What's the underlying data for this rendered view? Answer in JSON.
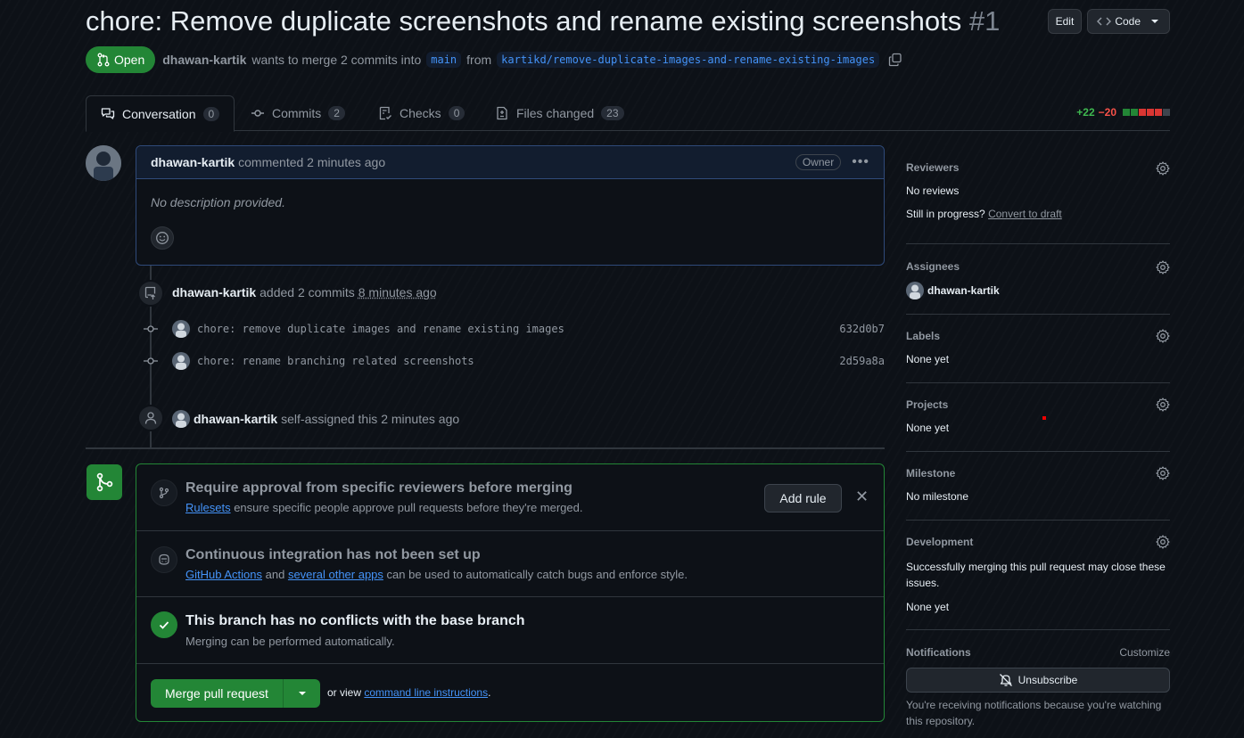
{
  "pr": {
    "title": "chore: Remove duplicate screenshots and rename existing screenshots",
    "number": "#1",
    "state": "Open",
    "author": "dhawan-kartik",
    "merge_text": "wants to merge 2 commits into",
    "base_branch": "main",
    "from_text": "from",
    "head_branch": "kartikd/remove-duplicate-images-and-rename-existing-images",
    "edit_label": "Edit",
    "code_label": "Code"
  },
  "tabs": [
    {
      "label": "Conversation",
      "count": "0"
    },
    {
      "label": "Commits",
      "count": "2"
    },
    {
      "label": "Checks",
      "count": "0"
    },
    {
      "label": "Files changed",
      "count": "23"
    }
  ],
  "diffstat": {
    "additions": "+22",
    "deletions": "−20",
    "colors": [
      "#238636",
      "#238636",
      "#da3633",
      "#da3633",
      "#da3633",
      "#3d444d"
    ]
  },
  "comment": {
    "author": "dhawan-kartik",
    "action": "commented 2 minutes ago",
    "badge": "Owner",
    "body": "No description provided."
  },
  "commits_event": {
    "author": "dhawan-kartik",
    "action": "added 2 commits",
    "time": "8 minutes ago",
    "commits": [
      {
        "message": "chore: remove duplicate images and rename existing images",
        "sha": "632d0b7"
      },
      {
        "message": "chore: rename branching related screenshots",
        "sha": "2d59a8a"
      }
    ]
  },
  "assign_event": {
    "author": "dhawan-kartik",
    "action": "self-assigned this 2 minutes ago"
  },
  "merge": {
    "ruleset": {
      "title": "Require approval from specific reviewers before merging",
      "link": "Rulesets",
      "text": "ensure specific people approve pull requests before they're merged.",
      "button": "Add rule"
    },
    "ci": {
      "title": "Continuous integration has not been set up",
      "link1": "GitHub Actions",
      "and": "and",
      "link2": "several other apps",
      "text": "can be used to automatically catch bugs and enforce style."
    },
    "conflicts": {
      "title": "This branch has no conflicts with the base branch",
      "text": "Merging can be performed automatically."
    },
    "button": "Merge pull request",
    "alt_prefix": "or view",
    "alt_link": "command line instructions",
    "alt_suffix": "."
  },
  "sidebar": {
    "reviewers": {
      "title": "Reviewers",
      "value": "No reviews",
      "progress": "Still in progress?",
      "draft_link": "Convert to draft"
    },
    "assignees": {
      "title": "Assignees",
      "value": "dhawan-kartik"
    },
    "labels": {
      "title": "Labels",
      "value": "None yet"
    },
    "projects": {
      "title": "Projects",
      "value": "None yet"
    },
    "milestone": {
      "title": "Milestone",
      "value": "No milestone"
    },
    "development": {
      "title": "Development",
      "text": "Successfully merging this pull request may close these issues.",
      "value": "None yet"
    },
    "notifications": {
      "title": "Notifications",
      "customize": "Customize",
      "button": "Unsubscribe",
      "text": "You're receiving notifications because you're watching this repository."
    }
  },
  "colors": {
    "accent": "#4493f8",
    "success": "#238636",
    "border": "#30363d",
    "bg": "#0d1117"
  }
}
